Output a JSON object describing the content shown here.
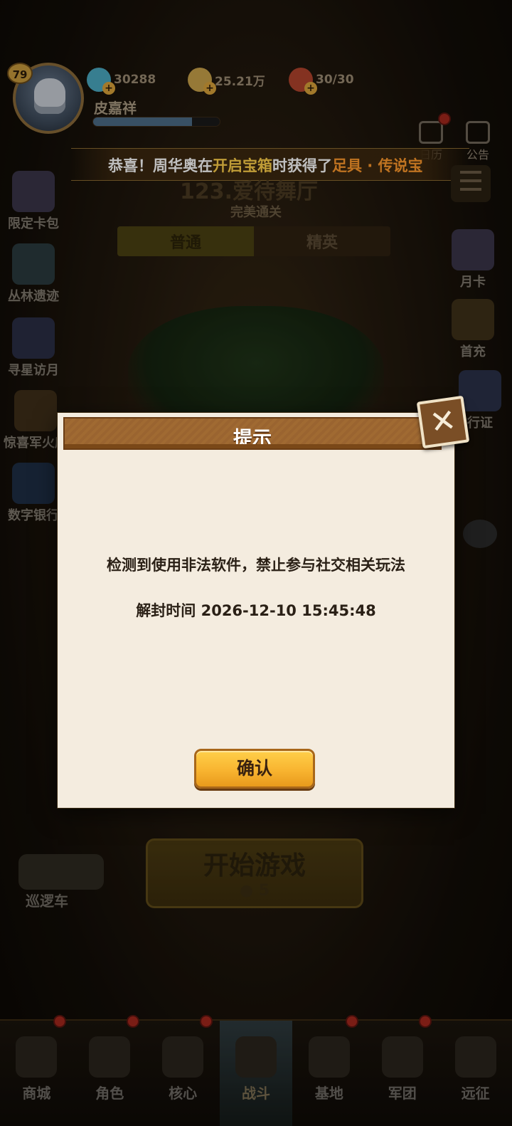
{
  "player": {
    "level": "79",
    "name": "皮嘉祥",
    "xp_fraction": 0.78
  },
  "resources": [
    {
      "icon": "gem-icon",
      "value": "30288",
      "color": "#4aa8c0"
    },
    {
      "icon": "gold-coin-icon",
      "value": "25.21万",
      "color": "#c9a24a"
    },
    {
      "icon": "meat-icon",
      "value": "30/30",
      "color": "#b0432c"
    }
  ],
  "top_icons": {
    "calendar": "日历",
    "notice": "公告"
  },
  "broadcast": {
    "part1": "恭喜！",
    "part2": "周华奥",
    "part3": "在",
    "part4": "开启宝箱",
    "part5": "时获得了",
    "part6": "足具 · 传说宝"
  },
  "stage": {
    "title": "123.爱待舞厅",
    "status": "完美通关",
    "tab_normal": "普通",
    "tab_elite": "精英"
  },
  "left_side": [
    "限定卡包",
    "丛林遗迹",
    "寻星访月",
    "惊喜军火库",
    "数字银行"
  ],
  "right_side": [
    "月卡",
    "首充",
    "行证"
  ],
  "start": {
    "label": "开始游戏",
    "cost": "5"
  },
  "patrol": "巡逻车",
  "nav": [
    "商城",
    "角色",
    "核心",
    "战斗",
    "基地",
    "军团",
    "远征"
  ],
  "dialog": {
    "title": "提示",
    "message": "检测到使用非法软件，禁止参与社交相关玩法",
    "unban_time": "解封时间 2026-12-10 15:45:48",
    "confirm": "确认"
  },
  "colors": {
    "accent_yellow": "#ffd04a",
    "accent_orange": "#ff9a2c",
    "dialog_bg": "#f4ecdf",
    "header_brown": "#a06a32"
  }
}
